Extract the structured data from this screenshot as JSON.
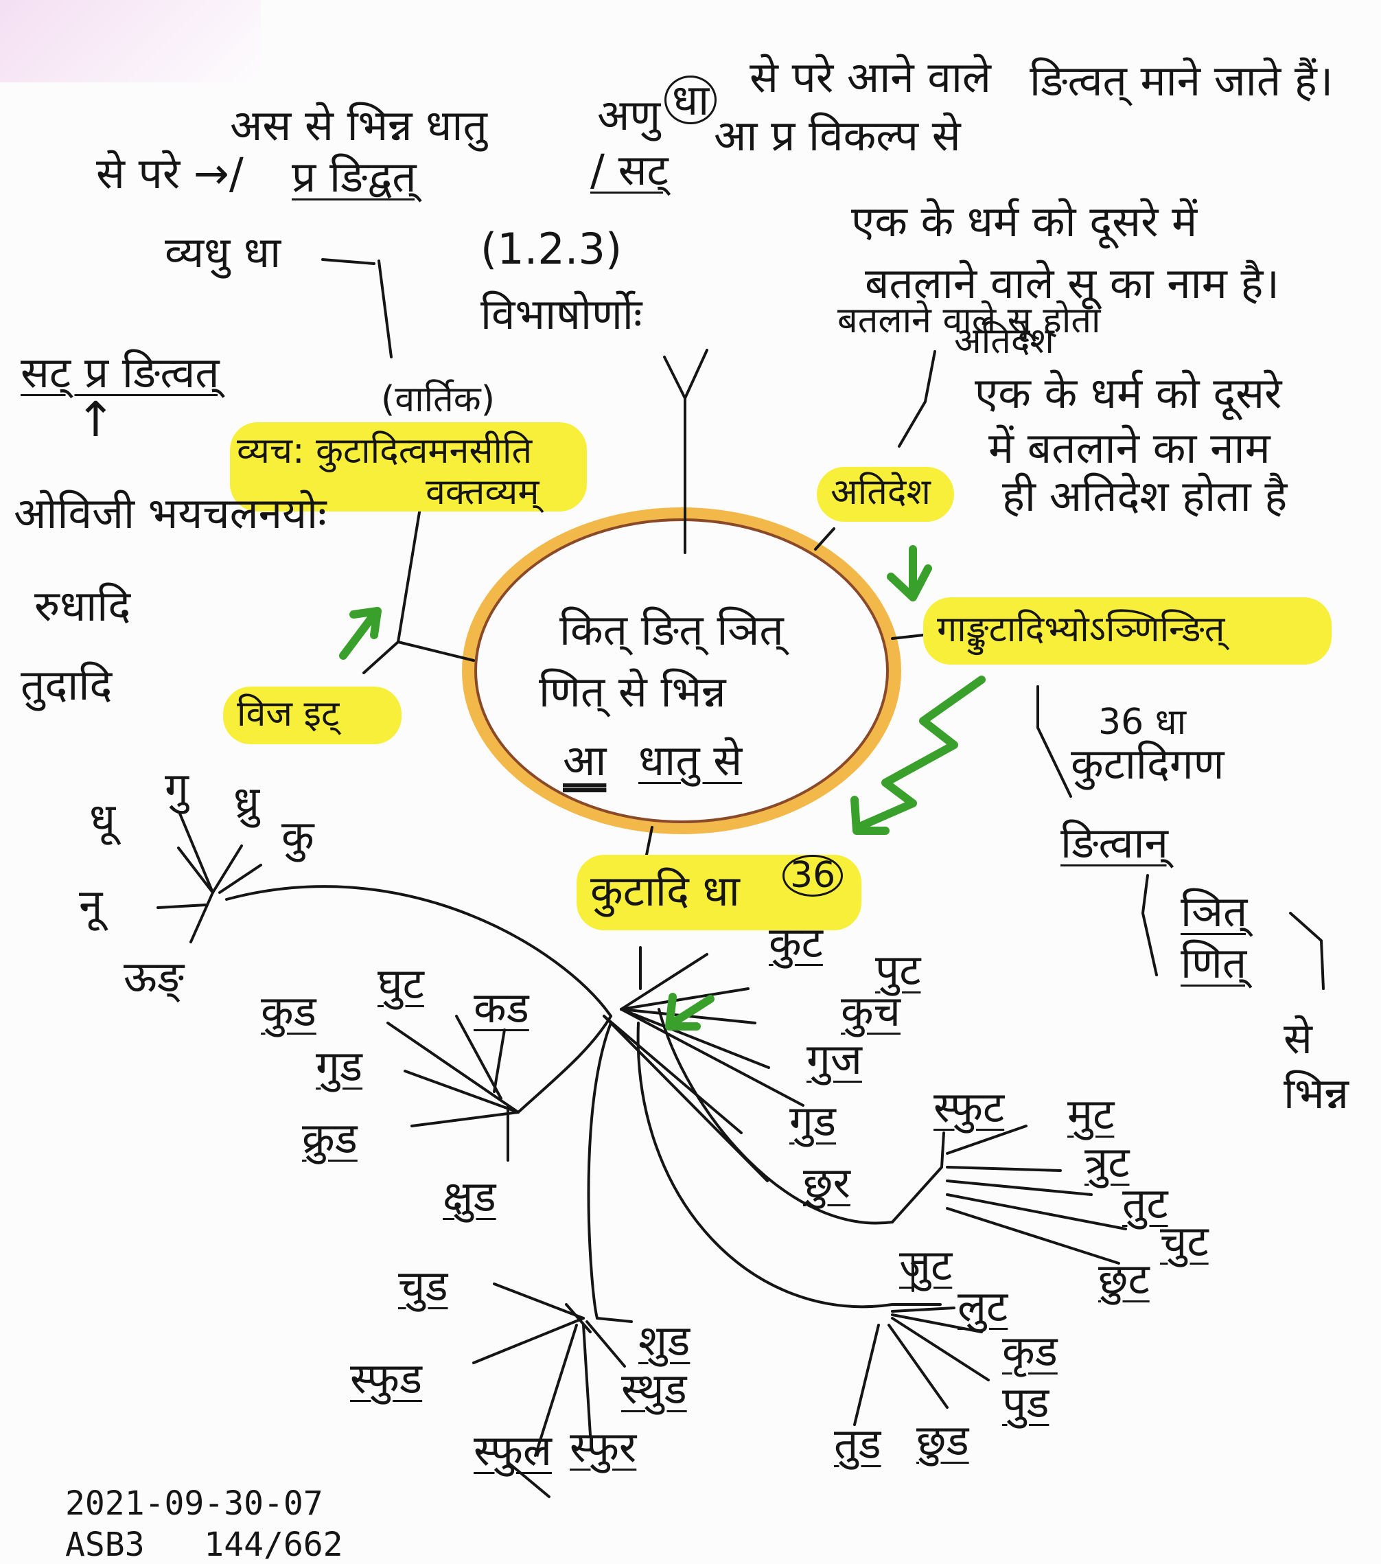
{
  "center": {
    "line1": "कित् ङित् ञित्",
    "line2": "णित् से भिन्न",
    "line3_a": "आ",
    "line3_b": "धातु से"
  },
  "top_right": {
    "line1_a": "अणु",
    "line1_num": "धा",
    "line1_b": "से परे आने वाले",
    "line1_c": "ङित्वत् माने जाते हैं।",
    "line2_a": "/ सट्",
    "line2_b": "आ प्र विकल्प से"
  },
  "top_left": {
    "line1": "अस से भिन्न धातु",
    "line2": "प्र ङिद्वत्",
    "line3": "से परे →/",
    "line4": "व्यधु धा"
  },
  "sutra_ref": {
    "number": "(1.2.3)",
    "label": "विभाषोर्णोः"
  },
  "vartika": {
    "label": "(वार्तिक)",
    "line1": "व्यच: कुटादित्वमनसीति",
    "line2": "वक्तव्यम्"
  },
  "left": {
    "sat": "सट् प्र ङित्वत्",
    "sutra": "ओविजी भयचलनयोः",
    "rudhadi": "रुधादि",
    "tudadi": "तुदादि",
    "vij": "विज इट्"
  },
  "atidesh": {
    "top_line1": "एक के धर्म को दूसरे में",
    "top_line2": "बतलाने वाले सू का नाम है।",
    "top_line3": "बतलाने वाले सू होता",
    "top_label": "अतिदेश",
    "def_line1": "एक के धर्म को दूसरे",
    "def_line2": "में बतलाने का नाम",
    "def_line3": "ही अतिदेश होता है",
    "label": "अतिदेश"
  },
  "right": {
    "sutra": "गाङ्कुटादिभ्योऽञ्णिन्ङित्",
    "count": "36 धा",
    "gana": "कुटादिगण",
    "ngitvan": "ङित्वान्",
    "jit": "ञित्",
    "nit": "णित्",
    "se": "से",
    "bhinn": "भिन्न"
  },
  "kutadi": {
    "label": "कुटादि धा",
    "count": "36"
  },
  "left_cluster": {
    "items": [
      "गु",
      "ध्रु",
      "कु",
      "धू",
      "नू",
      "ऊङ्"
    ]
  },
  "dhatu_group_a": [
    "कुट",
    "पुट",
    "कुच",
    "गुज",
    "गुड",
    "छुर"
  ],
  "dhatu_group_b": [
    "कुड",
    "घुट",
    "कड",
    "गुड",
    "क्रुड",
    "क्षुड"
  ],
  "dhatu_group_c": [
    "स्फुट",
    "मुट",
    "त्रुट",
    "तुट",
    "चुट",
    "छुट"
  ],
  "dhatu_group_d": [
    "जुट",
    "लुट",
    "कृड",
    "पुड",
    "तुड",
    "छुड"
  ],
  "dhatu_group_e": [
    "चुड",
    "शुड",
    "स्फुड",
    "स्थुड",
    "स्फुल",
    "स्फुर"
  ],
  "footer": {
    "date": "2021-09-30-07",
    "ref": "ASB3   144/662"
  },
  "colors": {
    "highlight": "#f7ef3a",
    "ring_outer": "#f2b84a",
    "ring_inner": "#8a4a2a",
    "arrow": "#3aa02c",
    "ink": "#151515"
  }
}
